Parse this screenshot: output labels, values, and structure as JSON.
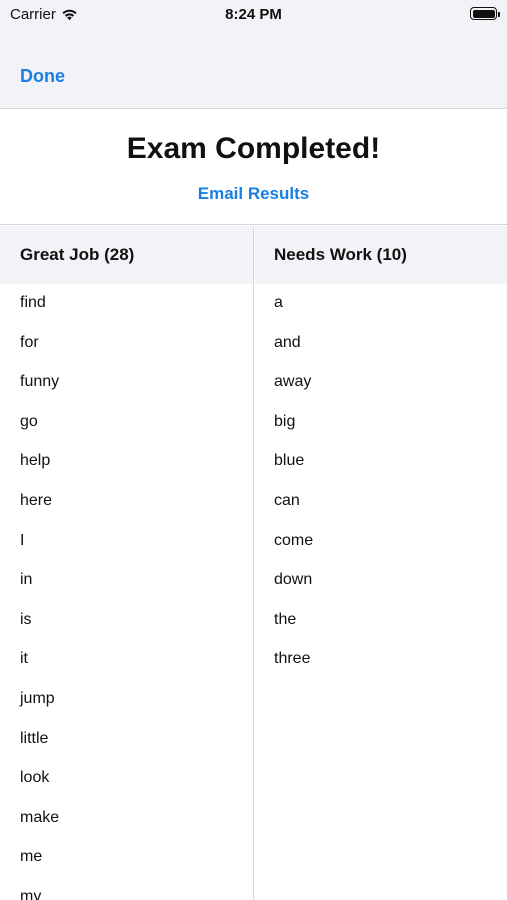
{
  "status_bar": {
    "carrier": "Carrier",
    "time": "8:24 PM",
    "wifi_icon": "wifi-icon",
    "battery_icon": "battery-icon"
  },
  "nav": {
    "done_label": "Done"
  },
  "header": {
    "title": "Exam Completed!",
    "email_label": "Email Results"
  },
  "great_job": {
    "header": "Great Job (28)",
    "words": [
      "find",
      "for",
      "funny",
      "go",
      "help",
      "here",
      "I",
      "in",
      "is",
      "it",
      "jump",
      "little",
      "look",
      "make",
      "me",
      "my"
    ]
  },
  "needs_work": {
    "header": "Needs Work (10)",
    "words": [
      "a",
      "and",
      "away",
      "big",
      "blue",
      "can",
      "come",
      "down",
      "the",
      "three"
    ]
  },
  "colors": {
    "accent": "#1a7fe3",
    "bar_background": "#f2f2f7",
    "divider": "#d6d6d6"
  }
}
